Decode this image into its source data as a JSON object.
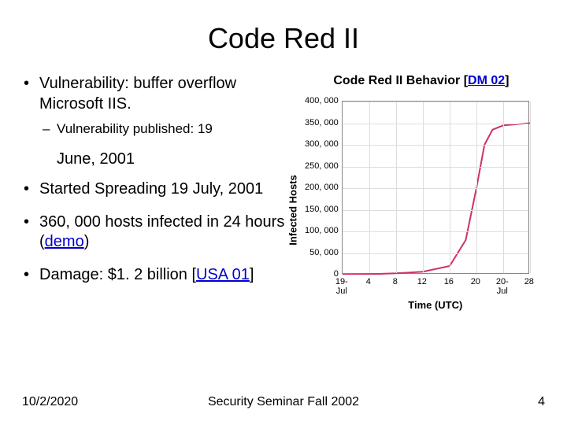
{
  "title": "Code Red II",
  "bullets": {
    "b1": "Vulnerability: buffer overflow Microsoft IIS.",
    "b1_sub_prefix": "Vulnerability published: ",
    "b1_sub_suffix": "19",
    "b1_sub_tail": "June, 2001",
    "b2": "Started Spreading 19 July, 2001",
    "b3_a": "360, 000 hosts infected in 24 hours (",
    "b3_link": "demo",
    "b3_b": ")",
    "b4_a": "Damage: $1. 2 billion [",
    "b4_link": "USA 01",
    "b4_b": "]"
  },
  "chart_title_a": "Code Red II Behavior [",
  "chart_title_link": "DM 02",
  "chart_title_b": "]",
  "footer": {
    "date": "10/2/2020",
    "venue": "Security Seminar Fall 2002",
    "page": "4"
  },
  "chart_data": {
    "type": "line",
    "title": "Code Red II Behavior",
    "xlabel": "Time (UTC)",
    "ylabel": "Infected Hosts",
    "ylim": [
      0,
      400000
    ],
    "y_ticks": [
      0,
      50000,
      100000,
      150000,
      200000,
      250000,
      300000,
      350000,
      400000
    ],
    "y_tick_labels": [
      "0",
      "50, 000",
      "100, 000",
      "150, 000",
      "200, 000",
      "250, 000",
      "300, 000",
      "350, 000",
      "400, 000"
    ],
    "x_tick_labels": [
      "19-Jul",
      "4",
      "8",
      "12",
      "16",
      "20",
      "20-Jul",
      "28"
    ],
    "series": [
      {
        "name": "infected",
        "x_index": [
          0,
          1,
          2,
          3,
          4,
          4.6,
          5.0,
          5.3,
          5.6,
          6,
          7
        ],
        "values": [
          0,
          1000,
          3000,
          7000,
          20000,
          80000,
          200000,
          300000,
          335000,
          345000,
          350000
        ]
      }
    ]
  }
}
